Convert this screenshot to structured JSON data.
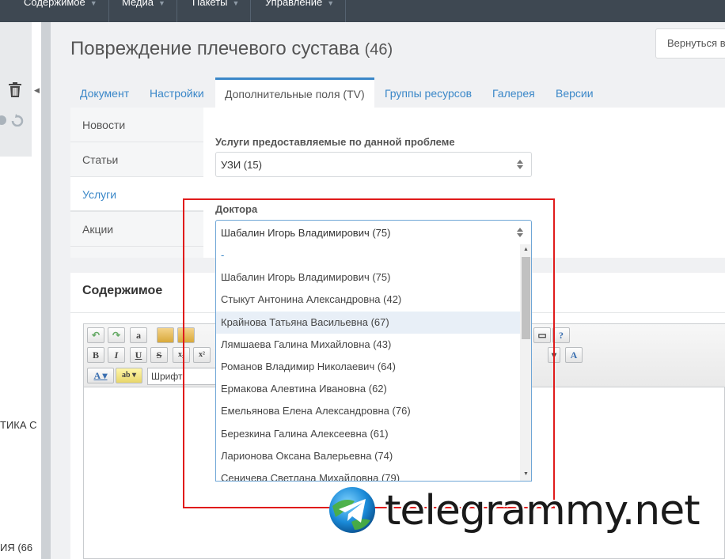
{
  "topnav": {
    "items": [
      {
        "label": "Содержимое"
      },
      {
        "label": "Медиа"
      },
      {
        "label": "Пакеты"
      },
      {
        "label": "Управление"
      }
    ]
  },
  "left": {
    "tree_label_1": "ТИКА С",
    "tree_label_2": "ИЯ (66"
  },
  "header": {
    "title": "Повреждение плечевого сустава",
    "count": "(46)",
    "back_button": "Вернуться в"
  },
  "tabs": [
    {
      "label": "Документ"
    },
    {
      "label": "Настройки"
    },
    {
      "label": "Дополнительные поля (TV)"
    },
    {
      "label": "Группы ресурсов"
    },
    {
      "label": "Галерея"
    },
    {
      "label": "Версии"
    }
  ],
  "tv_categories": [
    {
      "label": "Новости"
    },
    {
      "label": "Статьи"
    },
    {
      "label": "Услуги"
    },
    {
      "label": "Акции"
    }
  ],
  "services_field": {
    "label": "Услуги предоставляемые по данной проблеме",
    "value": "УЗИ (15)"
  },
  "doctors_field": {
    "label": "Доктора",
    "value": "Шабалин Игорь Владимирович (75)",
    "options": [
      "-",
      "Шабалин Игорь Владимирович (75)",
      "Стыкут Антонина Александровна (42)",
      "Крайнова Татьяна Васильевна (67)",
      "Лямшаева Галина Михайловна (43)",
      "Романов Владимир Николаевич (64)",
      "Ермакова Алевтина Ивановна (62)",
      "Емельянова Елена Александровна (76)",
      "Березкина Галина Алексеевна (61)",
      "Ларионова Оксана Валерьевна (74)",
      "Сеничева Светлана Михайловна (79)"
    ],
    "hovered_option": "Крайнова Татьяна Васильевна (67)"
  },
  "content": {
    "title": "Содержимое",
    "font_select": "Шрифт",
    "bold": "B",
    "italic": "I",
    "underline": "U",
    "strike": "S",
    "subscript": "x₂",
    "superscript": "x²"
  },
  "watermark": {
    "text": "telegrammy.net"
  },
  "colors": {
    "accent": "#3a87c8",
    "highlight": "#e01b1b",
    "topnav": "#3e4852"
  }
}
